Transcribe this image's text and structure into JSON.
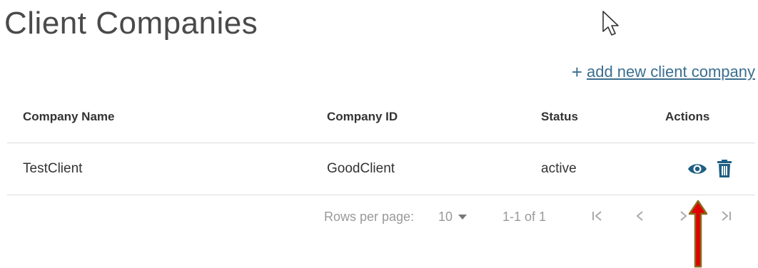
{
  "header": {
    "title": "Client Companies"
  },
  "toolbar": {
    "add_icon": "plus-icon",
    "add_label": "add new client company"
  },
  "table": {
    "columns": [
      "Company Name",
      "Company ID",
      "Status",
      "Actions"
    ],
    "rows": [
      {
        "name": "TestClient",
        "id": "GoodClient",
        "status": "active",
        "actions": [
          "view-eye-icon",
          "delete-trash-icon"
        ]
      }
    ]
  },
  "pagination": {
    "rows_per_page_label": "Rows per page:",
    "rows_per_page_value": "10",
    "range": "1-1 of 1",
    "buttons": [
      "first-page-icon",
      "previous-page-icon",
      "next-page-icon",
      "last-page-icon"
    ]
  },
  "colors": {
    "accent": "#1f5f82",
    "link": "#3b6e8f",
    "annotation_arrow": "#e00000",
    "annotation_arrow_border": "#8a6a1a"
  }
}
